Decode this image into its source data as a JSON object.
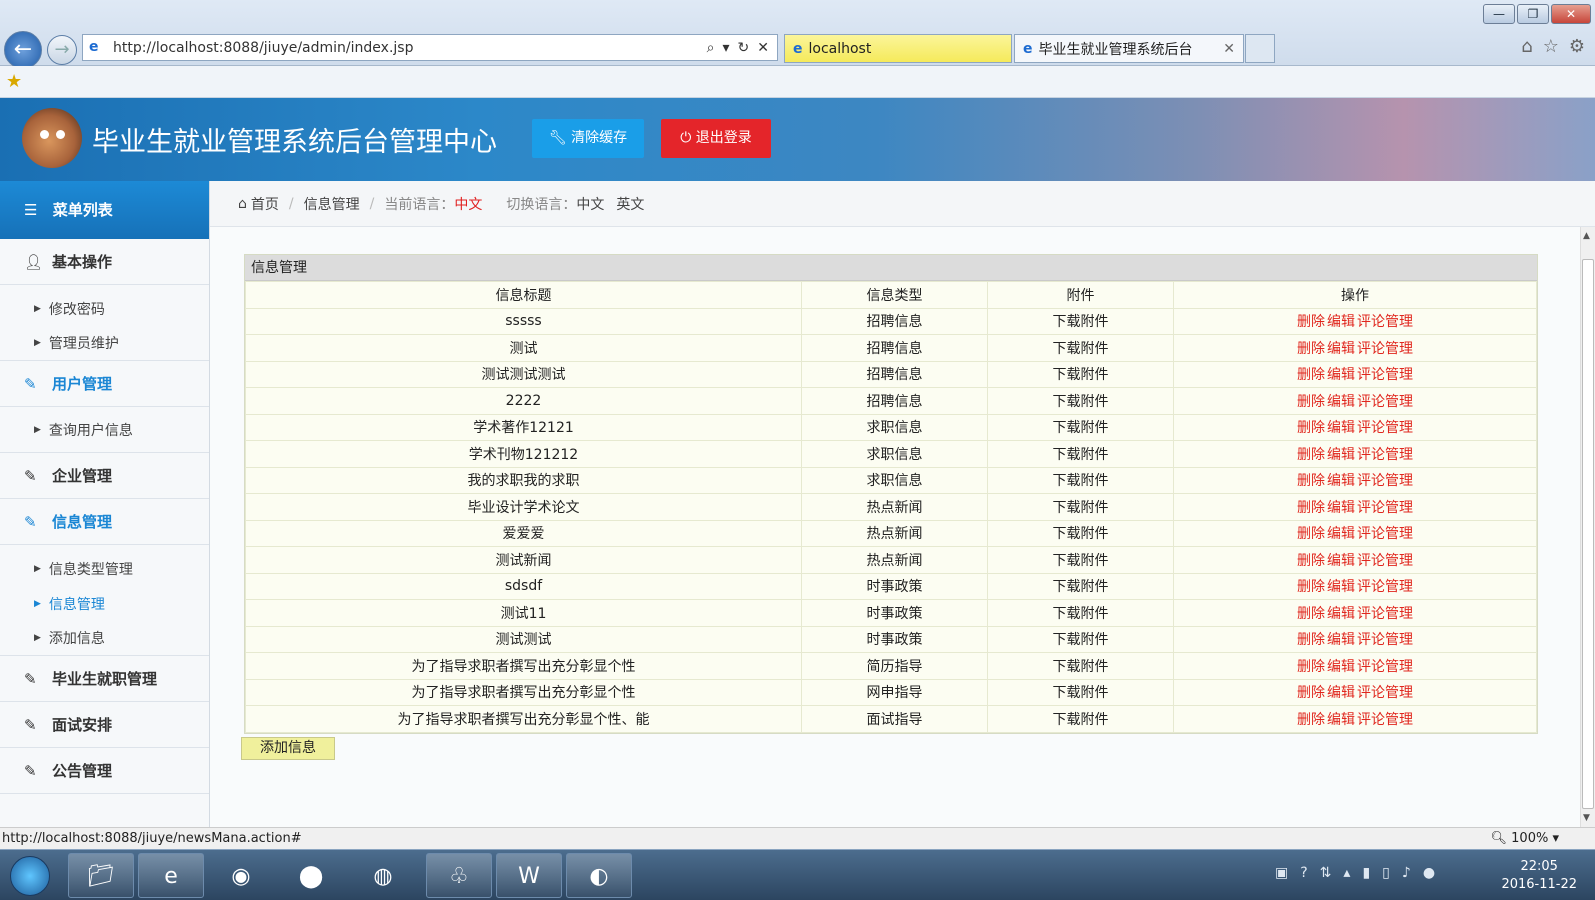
{
  "browser": {
    "url": "http://localhost:8088/jiuye/admin/index.jsp",
    "tabs": [
      {
        "label": "localhost"
      },
      {
        "label": "毕业生就业管理系统后台"
      }
    ],
    "status_url": "http://localhost:8088/jiuye/newsMana.action#",
    "zoom": "100%"
  },
  "header": {
    "title": "毕业生就业管理系统后台管理中心",
    "clear_cache": "清除缓存",
    "logout": "退出登录"
  },
  "sidebar": {
    "menu_title": "菜单列表",
    "sections": [
      {
        "label": "基本操作",
        "items": [
          "修改密码",
          "管理员维护"
        ]
      },
      {
        "label": "用户管理",
        "items": [
          "查询用户信息"
        ]
      },
      {
        "label": "企业管理",
        "items": []
      },
      {
        "label": "信息管理",
        "items": [
          "信息类型管理",
          "信息管理",
          "添加信息"
        ]
      },
      {
        "label": "毕业生就职管理",
        "items": []
      },
      {
        "label": "面试安排",
        "items": []
      },
      {
        "label": "公告管理",
        "items": []
      }
    ]
  },
  "breadcrumb": {
    "home": "首页",
    "current": "信息管理",
    "lang_label": "当前语言：",
    "lang_value": "中文",
    "switch_label": "切换语言：",
    "lang_cn": "中文",
    "lang_en": "英文"
  },
  "panel": {
    "title": "信息管理",
    "columns": [
      "信息标题",
      "信息类型",
      "附件",
      "操作"
    ],
    "op_delete": "删除",
    "op_edit": "编辑",
    "op_comment": "评论管理",
    "rows": [
      {
        "title": "sssss",
        "type": "招聘信息",
        "attach": "下载附件"
      },
      {
        "title": "测试",
        "type": "招聘信息",
        "attach": "下载附件"
      },
      {
        "title": "测试测试测试",
        "type": "招聘信息",
        "attach": "下载附件"
      },
      {
        "title": "2222",
        "type": "招聘信息",
        "attach": "下载附件"
      },
      {
        "title": "学术著作12121",
        "type": "求职信息",
        "attach": "下载附件"
      },
      {
        "title": "学术刊物121212",
        "type": "求职信息",
        "attach": "下载附件"
      },
      {
        "title": "我的求职我的求职",
        "type": "求职信息",
        "attach": "下载附件"
      },
      {
        "title": "毕业设计学术论文",
        "type": "热点新闻",
        "attach": "下载附件"
      },
      {
        "title": "爱爱爱",
        "type": "热点新闻",
        "attach": "下载附件"
      },
      {
        "title": "测试新闻",
        "type": "热点新闻",
        "attach": "下载附件"
      },
      {
        "title": "sdsdf",
        "type": "时事政策",
        "attach": "下载附件"
      },
      {
        "title": "测试11",
        "type": "时事政策",
        "attach": "下载附件"
      },
      {
        "title": "测试测试",
        "type": "时事政策",
        "attach": "下载附件"
      },
      {
        "title": "为了指导求职者撰写出充分彰显个性",
        "type": "简历指导",
        "attach": "下载附件"
      },
      {
        "title": "为了指导求职者撰写出充分彰显个性",
        "type": "网申指导",
        "attach": "下载附件"
      },
      {
        "title": "为了指导求职者撰写出充分彰显个性、能",
        "type": "面试指导",
        "attach": "下载附件"
      }
    ],
    "add_button": "添加信息"
  },
  "taskbar": {
    "time": "22:05",
    "date": "2016-11-22"
  }
}
